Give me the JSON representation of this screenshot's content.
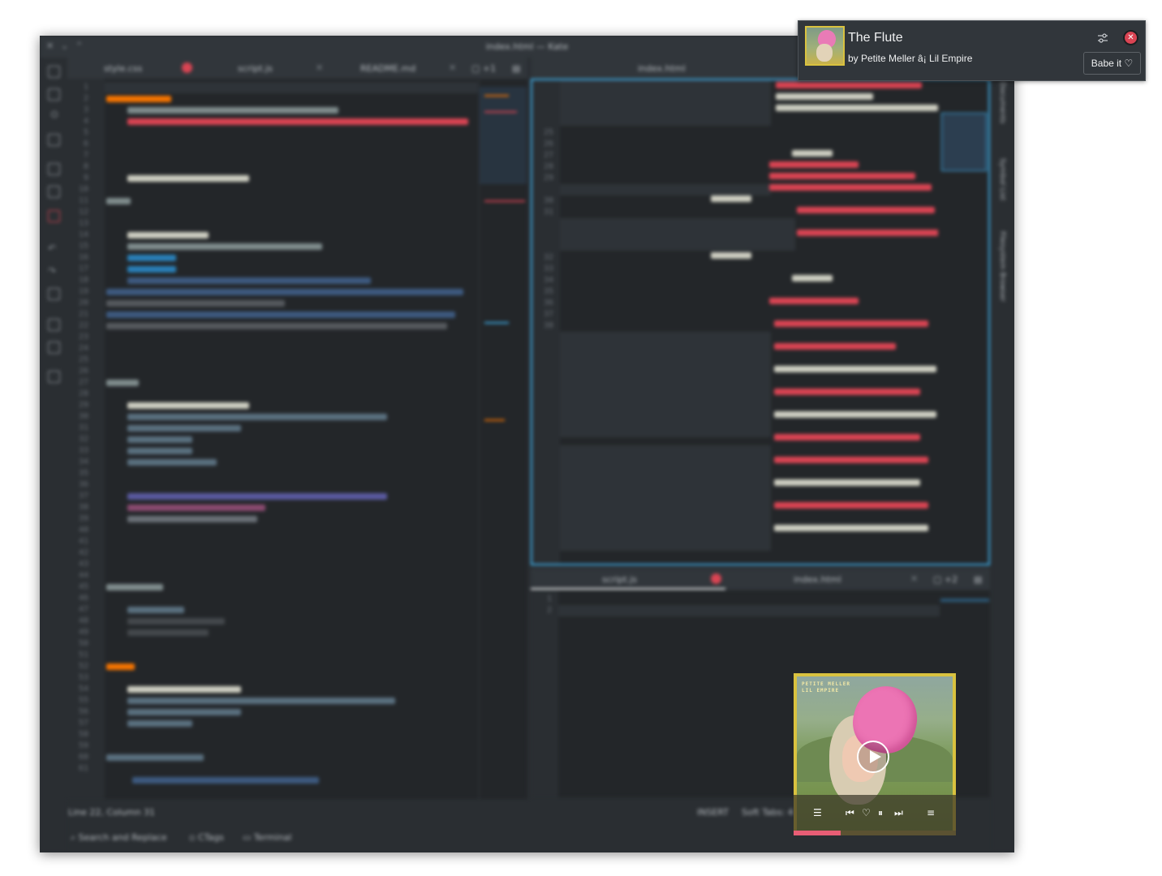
{
  "kate": {
    "window_title": "index.html — Kate",
    "left_tabs": [
      {
        "label": "style.css"
      },
      {
        "label": "script.js"
      },
      {
        "label": "README.md"
      }
    ],
    "left_tab_overflow": "+1",
    "right_top_tab": "index.html",
    "right_bottom_tabs": [
      {
        "label": "script.js"
      },
      {
        "label": "index.html"
      }
    ],
    "right_bottom_overflow": "+2",
    "right_pane_line_numbers": "25\n26\n27\n28\n29\n\n30\n31\n\n\n\n32\n33\n34\n35\n36\n37\n38",
    "left_line_numbers": "1\n2\n3\n4\n5\n6\n7\n8\n9\n10\n11\n12\n13\n14\n15\n16\n17\n18\n19\n20\n21\n22\n23\n24\n25\n26\n27\n28\n29\n30\n31\n32\n33\n34\n35\n36\n37\n38\n39\n40\n41\n42\n43\n44\n45\n46\n47\n48\n49\n50\n51\n52\n53\n54\n55\n56\n57\n58\n59\n60\n61",
    "bottom_pane_line_numbers": "1\n2",
    "status_left": "Line 22, Column 31",
    "status_mode": "INSERT",
    "status_tabs": "Soft Tabs: 4",
    "bottom_tools": [
      "Search and Replace",
      "CTags",
      "Terminal"
    ],
    "sidebar_labels": [
      "Documents",
      "Symbol List",
      "Filesystem Browser"
    ]
  },
  "notification": {
    "title": "The Flute",
    "subtitle": "by Petite Meller â¡ Lil Empire",
    "action_label": "Babe it ♡",
    "settings_icon": "settings-icon",
    "close_icon": "close-icon",
    "colors": {
      "close": "#da4453",
      "background": "#31363b"
    }
  },
  "player": {
    "cover_text": "PETITE MELLER\nLIL EMPIRE",
    "progress": 0.29,
    "icons": [
      "playlist-icon",
      "previous-icon",
      "heart-icon",
      "pause-icon",
      "next-icon",
      "queue-icon"
    ],
    "colors": {
      "frame": "#d9c23f",
      "progress": "#e85d75"
    }
  }
}
